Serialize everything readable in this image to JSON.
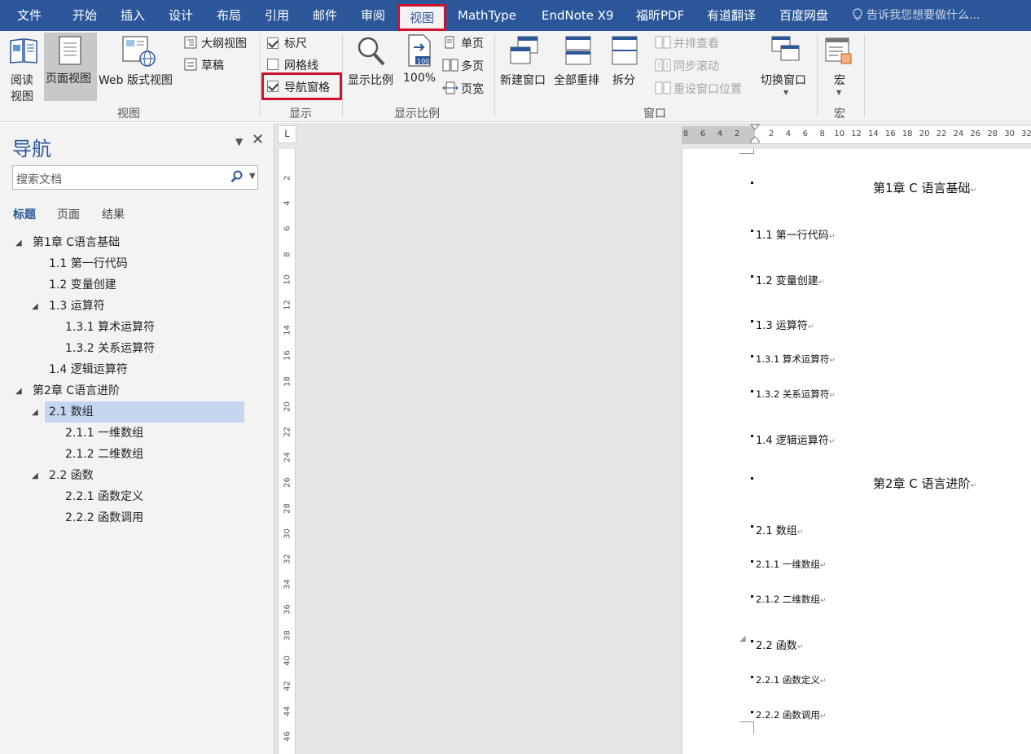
{
  "menubar": {
    "tabs": [
      "文件",
      "开始",
      "插入",
      "设计",
      "布局",
      "引用",
      "邮件",
      "审阅",
      "视图",
      "MathType",
      "EndNote X9",
      "福昕PDF",
      "有道翻译",
      "百度网盘"
    ],
    "active_tab": "视图",
    "tell_me": "告诉我您想要做什么..."
  },
  "ribbon": {
    "views": {
      "read_line1": "阅读",
      "read_line2": "视图",
      "print_layout": "页面视图",
      "web_layout": "Web 版式视图",
      "outline": "大纲视图",
      "draft": "草稿",
      "group": "视图"
    },
    "show": {
      "ruler": "标尺",
      "ruler_checked": true,
      "gridlines": "网格线",
      "gridlines_checked": false,
      "nav_pane": "导航窗格",
      "nav_pane_checked": true,
      "group": "显示"
    },
    "zoom": {
      "zoom": "显示比例",
      "hundred": "100%",
      "hundred_icon": "100",
      "one_page": "单页",
      "multi_page": "多页",
      "page_width": "页宽",
      "group": "显示比例"
    },
    "window": {
      "new_window": "新建窗口",
      "arrange_all": "全部重排",
      "split": "拆分",
      "side_by_side": "并排查看",
      "sync_scroll": "同步滚动",
      "reset_position": "重设窗口位置",
      "switch_window": "切换窗口",
      "group": "窗口"
    },
    "macros": {
      "macros": "宏",
      "group": "宏"
    }
  },
  "navpane": {
    "title": "导航",
    "search_placeholder": "搜索文档",
    "tabs": [
      "标题",
      "页面",
      "结果"
    ],
    "active_tab": "标题",
    "tree": [
      {
        "label": "第1章 C语言基础",
        "level": 0,
        "expanded": true
      },
      {
        "label": "1.1 第一行代码",
        "level": 1
      },
      {
        "label": "1.2 变量创建",
        "level": 1
      },
      {
        "label": "1.3 运算符",
        "level": 1,
        "expanded": true
      },
      {
        "label": "1.3.1 算术运算符",
        "level": 2
      },
      {
        "label": "1.3.2 关系运算符",
        "level": 2
      },
      {
        "label": "1.4 逻辑运算符",
        "level": 1
      },
      {
        "label": "第2章 C语言进阶",
        "level": 0,
        "expanded": true
      },
      {
        "label": "2.1 数组",
        "level": 1,
        "expanded": true,
        "selected": true
      },
      {
        "label": "2.1.1 一维数组",
        "level": 2
      },
      {
        "label": "2.1.2 二维数组",
        "level": 2
      },
      {
        "label": "2.2 函数",
        "level": 1,
        "expanded": true
      },
      {
        "label": "2.2.1 函数定义",
        "level": 2
      },
      {
        "label": "2.2.2 函数调用",
        "level": 2
      }
    ]
  },
  "ruler": {
    "corner": "L",
    "vertical": [
      "2",
      "4",
      "6",
      "8",
      "10",
      "12",
      "14",
      "16",
      "18",
      "20",
      "22",
      "24",
      "26",
      "28",
      "30",
      "32",
      "34",
      "36",
      "38",
      "40",
      "42",
      "44",
      "46"
    ],
    "horizontal": [
      "8",
      "6",
      "4",
      "2",
      "2",
      "4",
      "6",
      "8",
      "10",
      "12",
      "14",
      "16",
      "18",
      "20",
      "22",
      "24",
      "26",
      "28",
      "30",
      "32"
    ]
  },
  "document": {
    "lines": [
      {
        "text": "第1章  C 语言基础",
        "type": "chapter"
      },
      {
        "text": "1.1 第一行代码",
        "type": "h2"
      },
      {
        "text": "1.2 变量创建",
        "type": "h2"
      },
      {
        "text": "1.3 运算符",
        "type": "h2"
      },
      {
        "text": "1.3.1 算术运算符",
        "type": "h3"
      },
      {
        "text": "1.3.2 关系运算符",
        "type": "h3"
      },
      {
        "text": "1.4 逻辑运算符",
        "type": "h2"
      },
      {
        "text": "第2章  C 语言进阶",
        "type": "chapter"
      },
      {
        "text": "2.1  数组",
        "type": "h2"
      },
      {
        "text": "2.1.1 一维数组",
        "type": "h3"
      },
      {
        "text": "2.1.2 二维数组",
        "type": "h3"
      },
      {
        "text": "2.2 函数",
        "type": "h2"
      },
      {
        "text": "2.2.1 函数定义",
        "type": "h3"
      },
      {
        "text": "2.2.2 函数调用",
        "type": "h3"
      }
    ],
    "para_mark": "↵"
  },
  "colors": {
    "brand": "#2b579a",
    "highlight_box": "#d0102b",
    "selection": "#c5d6f1"
  }
}
